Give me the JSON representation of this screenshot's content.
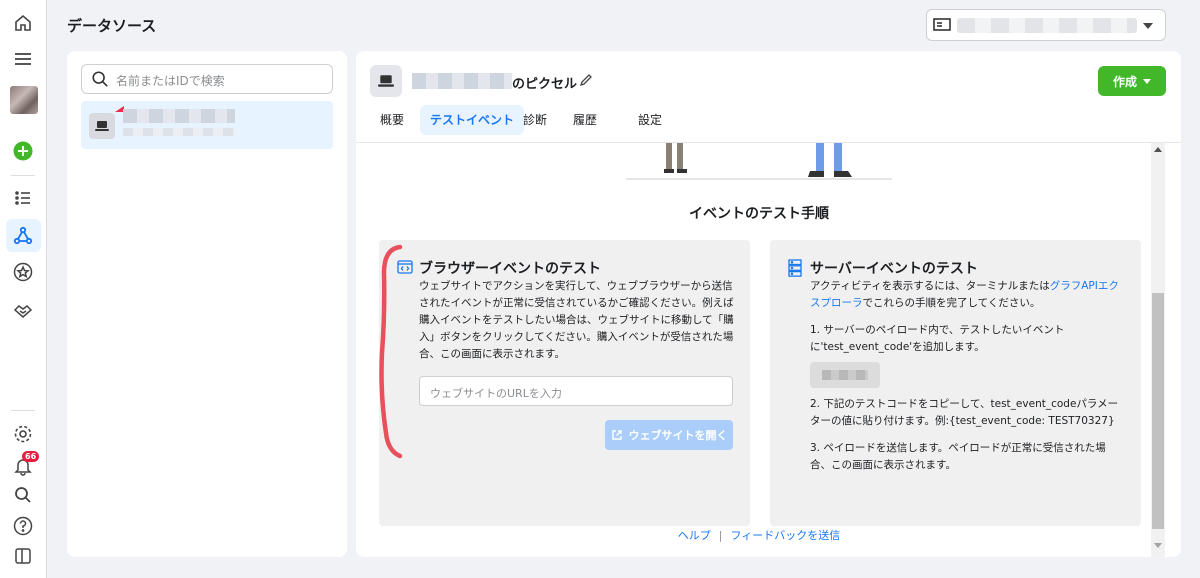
{
  "header": {
    "title": "データソース"
  },
  "nav": {
    "notification_count": "66"
  },
  "left": {
    "search_placeholder": "名前またはIDで検索"
  },
  "pixel": {
    "name_suffix": "のピクセル",
    "create_label": "作成",
    "tabs": [
      "概要",
      "テストイベント",
      "診断",
      "履歴",
      "設定"
    ],
    "active_tab": "テストイベント"
  },
  "test": {
    "section_title": "イベントのテスト手順",
    "browser": {
      "title": "ブラウザーイベントのテスト",
      "desc": "ウェブサイトでアクションを実行して、ウェブブラウザーから送信されたイベントが正常に受信されているかご確認ください。例えば購入イベントをテストしたい場合は、ウェブサイトに移動して「購入」ボタンをクリックしてください。購入イベントが受信された場合、この画面に表示されます。",
      "url_placeholder": "ウェブサイトのURLを入力",
      "open_button": "ウェブサイトを開く"
    },
    "server": {
      "title": "サーバーイベントのテスト",
      "intro_before": "アクティビティを表示するには、ターミナルまたは",
      "intro_link": "グラフAPIエクスプローラ",
      "intro_after": "でこれらの手順を完了してください。",
      "step1": "1. サーバーのペイロード内で、テストしたいイベントに'test_event_code'を追加します。",
      "step2": "2. 下記のテストコードをコピーして、test_event_codeパラメーターの値に貼り付けます。例:{test_event_code: TEST70327}",
      "step3": "3. ペイロードを送信します。ペイロードが正常に受信された場合、この画面に表示されます。"
    }
  },
  "footer": {
    "help": "ヘルプ",
    "feedback": "フィードバックを送信"
  }
}
